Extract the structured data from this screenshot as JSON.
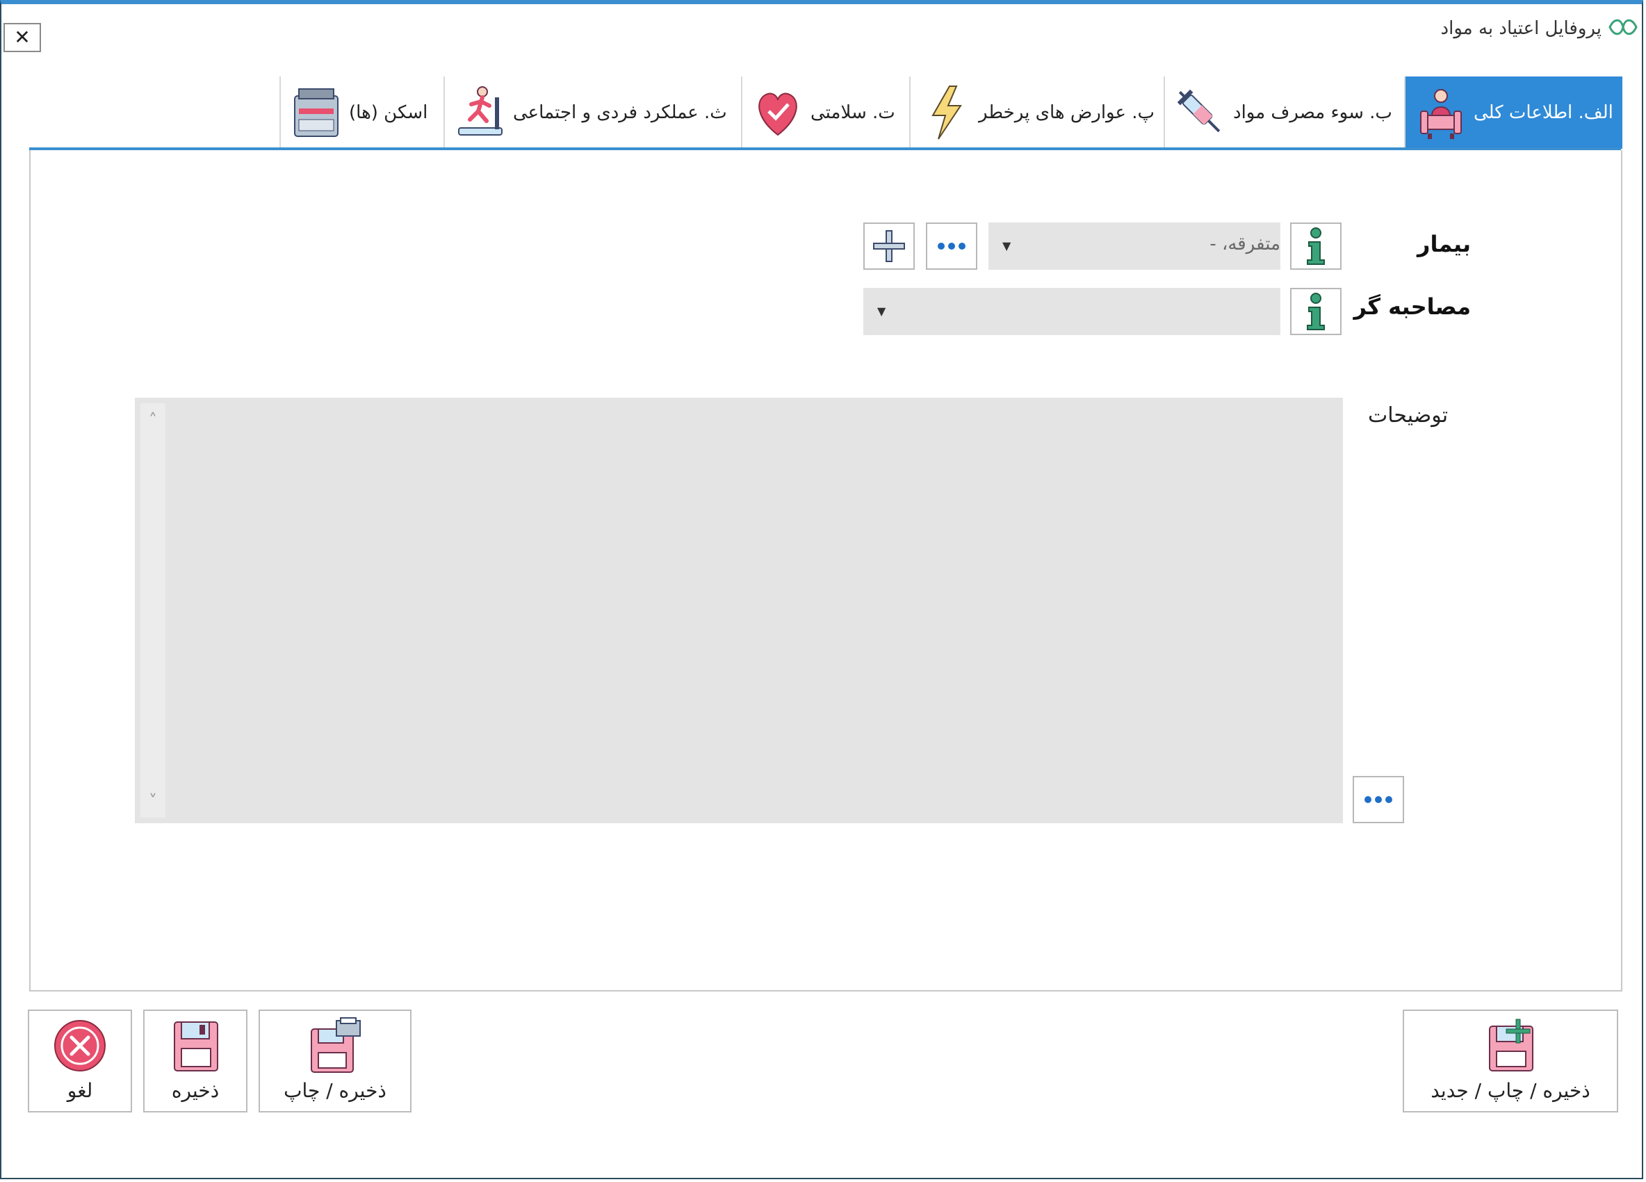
{
  "window": {
    "title": "پروفایل اعتیاد به مواد",
    "close_label": "✕"
  },
  "tabs": [
    {
      "label": "الف. اطلاعات کلی",
      "icon": "person-chair-icon",
      "active": true
    },
    {
      "label": "ب. سوء مصرف مواد",
      "icon": "syringe-icon",
      "active": false
    },
    {
      "label": "پ. عوارض های پرخطر",
      "icon": "lightning-icon",
      "active": false
    },
    {
      "label": "ت. سلامتی",
      "icon": "heart-check-icon",
      "active": false
    },
    {
      "label": "ث. عملکرد فردی و اجتماعی",
      "icon": "treadmill-icon",
      "active": false
    },
    {
      "label": "اسکن (ها)",
      "icon": "scanner-icon",
      "active": false
    }
  ],
  "form": {
    "patient_label": "بیمار",
    "patient_value": "متفرقه، -",
    "interviewer_label": "مصاحبه گر",
    "interviewer_value": "",
    "notes_label": "توضیحات",
    "notes_value": ""
  },
  "buttons": {
    "save_print_new": "ذخیره / چاپ / جدید",
    "save_print": "ذخیره / چاپ",
    "save": "ذخیره",
    "cancel": "لغو"
  },
  "colors": {
    "accent": "#2f8ad8",
    "field_bg": "#e4e4e4",
    "info_green": "#3aa37a",
    "cancel_red": "#e8506e"
  }
}
